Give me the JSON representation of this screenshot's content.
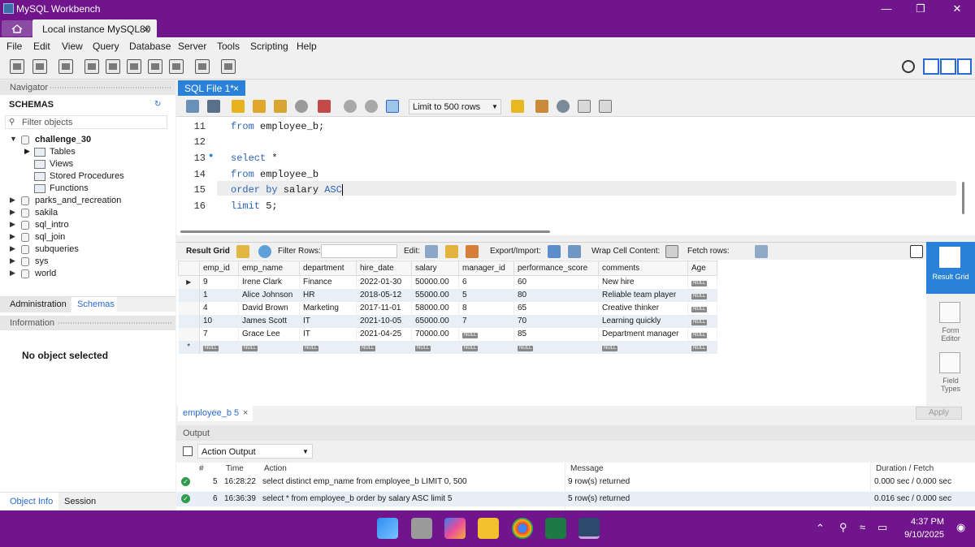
{
  "window": {
    "title": "MySQL Workbench"
  },
  "connection_tab": {
    "label": "Local instance MySQL80",
    "close": "×"
  },
  "menu": [
    "File",
    "Edit",
    "View",
    "Query",
    "Database",
    "Server",
    "Tools",
    "Scripting",
    "Help"
  ],
  "navigator": {
    "header": "Navigator",
    "schemas_title": "SCHEMAS",
    "filter_placeholder": "Filter objects",
    "schemas": [
      {
        "name": "challenge_30",
        "expanded": true,
        "bold": true,
        "children": [
          "Tables",
          "Views",
          "Stored Procedures",
          "Functions"
        ]
      },
      {
        "name": "parks_and_recreation"
      },
      {
        "name": "sakila"
      },
      {
        "name": "sql_intro"
      },
      {
        "name": "sql_join"
      },
      {
        "name": "subqueries"
      },
      {
        "name": "sys"
      },
      {
        "name": "world"
      }
    ],
    "tabs": [
      "Administration",
      "Schemas"
    ],
    "info_header": "Information",
    "no_object": "No object selected",
    "bottom_tabs": [
      "Object Info",
      "Session"
    ]
  },
  "sql_tab": {
    "label": "SQL File 1*",
    "close": "×"
  },
  "sql_toolbar": {
    "limit": "Limit to 500 rows"
  },
  "editor": {
    "lines": [
      {
        "num": "11",
        "marker": "",
        "tokens": [
          {
            "t": "from",
            "kw": true
          },
          {
            "t": " employee_b;"
          }
        ]
      },
      {
        "num": "12",
        "marker": "",
        "tokens": []
      },
      {
        "num": "13",
        "marker": "●",
        "tokens": [
          {
            "t": "select",
            "kw": true
          },
          {
            "t": " *"
          }
        ]
      },
      {
        "num": "14",
        "marker": "",
        "tokens": [
          {
            "t": "from",
            "kw": true
          },
          {
            "t": " employee_b"
          }
        ]
      },
      {
        "num": "15",
        "marker": "",
        "tokens": [
          {
            "t": "order by",
            "kw": true
          },
          {
            "t": " salary "
          },
          {
            "t": "ASC",
            "kw": true
          }
        ]
      },
      {
        "num": "16",
        "marker": "",
        "tokens": [
          {
            "t": "limit",
            "kw": true
          },
          {
            "t": " 5;"
          }
        ]
      }
    ]
  },
  "result_toolbar": {
    "result_grid": "Result Grid",
    "filter_rows": "Filter Rows:",
    "edit": "Edit:",
    "export_import": "Export/Import:",
    "wrap": "Wrap Cell Content:",
    "fetch": "Fetch rows:"
  },
  "grid": {
    "columns": [
      "emp_id",
      "emp_name",
      "department",
      "hire_date",
      "salary",
      "manager_id",
      "performance_score",
      "comments",
      "Age"
    ],
    "rows": [
      [
        "9",
        "Irene Clark",
        "Finance",
        "2022-01-30",
        "50000.00",
        "6",
        "60",
        "New hire",
        "NULL"
      ],
      [
        "1",
        "Alice Johnson",
        "HR",
        "2018-05-12",
        "55000.00",
        "5",
        "80",
        "Reliable team player",
        "NULL"
      ],
      [
        "4",
        "David Brown",
        "Marketing",
        "2017-11-01",
        "58000.00",
        "8",
        "65",
        "Creative thinker",
        "NULL"
      ],
      [
        "10",
        "James Scott",
        "IT",
        "2021-10-05",
        "65000.00",
        "7",
        "70",
        "Learning quickly",
        "NULL"
      ],
      [
        "7",
        "Grace Lee",
        "IT",
        "2021-04-25",
        "70000.00",
        "NULL",
        "85",
        "Department manager",
        "NULL"
      ]
    ],
    "new_row_marker": "*",
    "null_label": "NULL"
  },
  "side_panel": [
    {
      "label": "Result Grid",
      "active": true
    },
    {
      "label": "Form Editor",
      "active": false
    },
    {
      "label": "Field Types",
      "active": false
    }
  ],
  "result_tab": {
    "label": "employee_b 5",
    "close": "×"
  },
  "apply_label": "Apply",
  "output": {
    "header": "Output",
    "selector": "Action Output",
    "columns": [
      "#",
      "Time",
      "Action",
      "Message",
      "Duration / Fetch"
    ],
    "rows": [
      {
        "num": "5",
        "time": "16:28:22",
        "action": "select distinct emp_name from employee_b LIMIT 0, 500",
        "message": "9 row(s) returned",
        "duration": "0.000 sec / 0.000 sec"
      },
      {
        "num": "6",
        "time": "16:36:39",
        "action": "select * from employee_b order by salary ASC limit 5",
        "message": "5 row(s) returned",
        "duration": "0.016 sec / 0.000 sec"
      }
    ]
  },
  "taskbar": {
    "time": "4:37 PM",
    "date": "9/10/2025"
  },
  "colors": {
    "accent": "#70158c",
    "tab_blue": "#2a82d8",
    "ok_green": "#2e9b4c"
  }
}
